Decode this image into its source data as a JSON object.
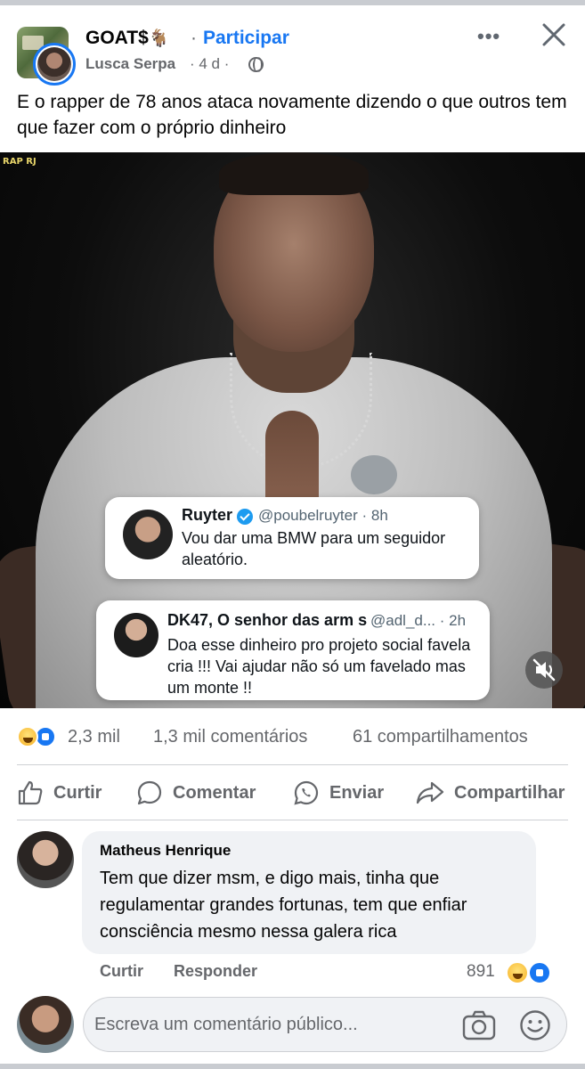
{
  "post": {
    "group_name": "GOAT$",
    "group_emoji": "🐐",
    "separator": "·",
    "join_label": "Participar",
    "author": "Lusca Serpa",
    "meta": "· 4 d ·",
    "text": "E o rapper de 78 anos ataca novamente dizendo o que outros tem que fazer com o próprio dinheiro",
    "more_icon": "more-horizontal-icon",
    "close_icon": "close-icon"
  },
  "media": {
    "watermark": "RAP RJ",
    "tweet1": {
      "name": "Ruyter",
      "handle": "@poubelruyter · 8h",
      "text": "Vou dar uma BMW para um seguidor aleatório."
    },
    "tweet2": {
      "name": "DK47, O senhor das arm  s",
      "handle": "@adl_d... · 2h",
      "text": "Doa esse dinheiro pro projeto social favela cria !!! Vai ajudar não só um favelado mas um monte !!"
    },
    "mute_icon": "speaker-muted-icon"
  },
  "stats": {
    "reactions": "2,3 mil",
    "comments": "1,3 mil comentários",
    "shares": "61 compartilhamentos"
  },
  "actions": {
    "like": "Curtir",
    "comment": "Comentar",
    "send": "Enviar",
    "share": "Compartilhar"
  },
  "comment": {
    "author": "Matheus Henrique",
    "text": "Tem que dizer msm, e digo mais, tinha que regulamentar grandes fortunas, tem que enfiar consciência mesmo nessa galera rica",
    "like_label": "Curtir",
    "reply_label": "Responder",
    "reaction_count": "891"
  },
  "composer": {
    "placeholder": "Escreva um comentário público..."
  },
  "colors": {
    "accent": "#1877f2",
    "secondary_text": "#65676b",
    "bubble_bg": "#f0f2f5"
  }
}
